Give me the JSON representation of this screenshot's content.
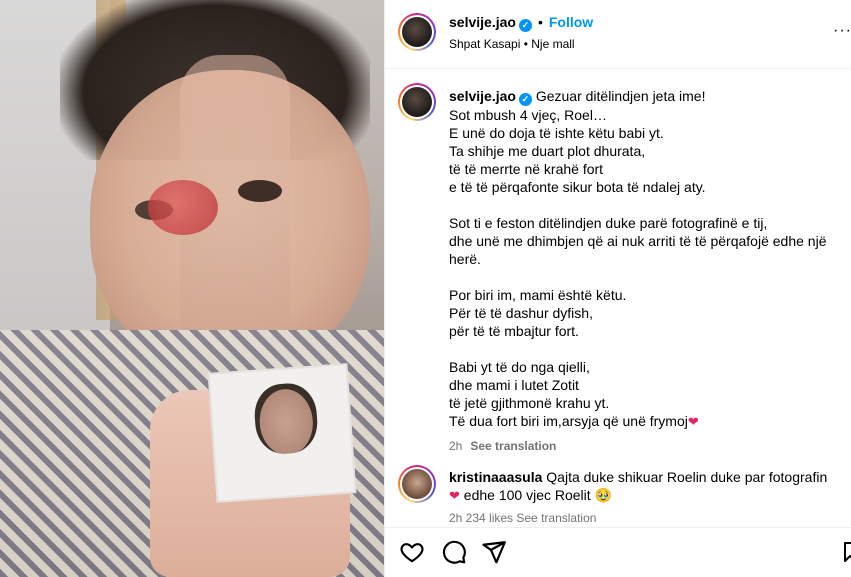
{
  "post_header": {
    "username": "selvije.jao",
    "verified_glyph": "✓",
    "separator": "•",
    "follow_label": "Follow",
    "location": "Shpat Kasapi • Nje mall",
    "more_glyph": "···"
  },
  "caption": {
    "username": "selvije.jao",
    "paragraphs": [
      "Gezuar ditëlindjen jeta ime!\nSot mbush 4 vjeç, Roel…\nE unë do doja të ishte këtu babi yt.\nTa shihje me duart plot dhurata,\ntë të merrte në krahë fort\ne të të përqafonte sikur bota të ndalej aty.",
      "Sot ti e feston ditëlindjen duke parë fotografinë e tij,\ndhe unë me dhimbjen që ai nuk arriti të të përqafojë edhe një herë.",
      "Por biri im, mami është këtu.\nPër të të dashur dyfish,\npër të të mbajtur fort.",
      "Babi yt të do nga qielli,\ndhe mami i lutet Zotit\ntë jetë gjithmonë krahu yt.\nTë dua fort biri im,arsyja që unë frymoj"
    ],
    "end_heart": "❤",
    "time": "2h",
    "see_translation": "See translation"
  },
  "comment": {
    "username": "kristinaaasula",
    "text": "Qajta duke shikuar Roelin duke par fotografin",
    "heart": "❤",
    "text2": "edhe 100 vjec Roelit 🥹",
    "meta": "2h   234 likes   See translation"
  },
  "actions": {
    "like_icon": "heart-outline-icon",
    "comment_icon": "comment-bubble-icon",
    "share_icon": "paper-plane-icon",
    "save_icon": "bookmark-icon"
  },
  "colors": {
    "accent": "#0095f6",
    "secondary_text": "#737373",
    "heart": "#e0245e"
  }
}
